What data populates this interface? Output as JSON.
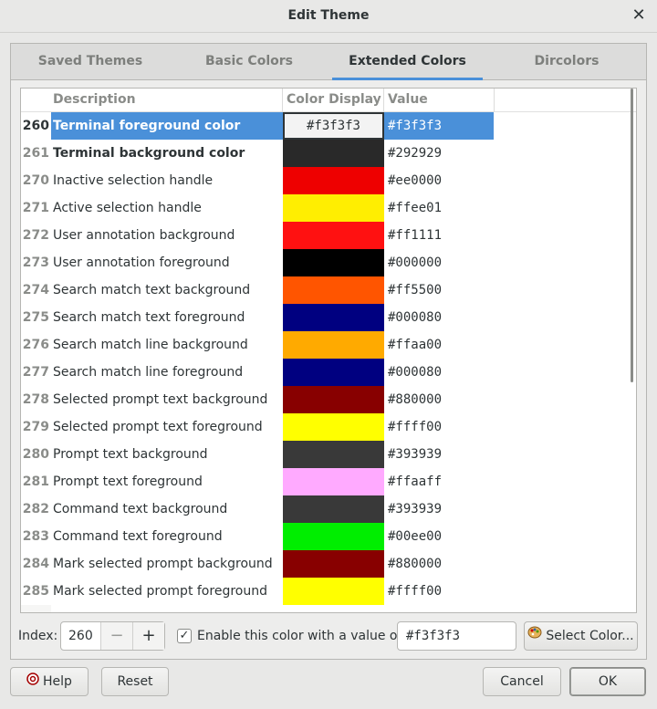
{
  "window": {
    "title": "Edit Theme"
  },
  "tabs": [
    {
      "label": "Saved Themes",
      "active": false
    },
    {
      "label": "Basic Colors",
      "active": false
    },
    {
      "label": "Extended Colors",
      "active": true
    },
    {
      "label": "Dircolors",
      "active": false
    }
  ],
  "columns": {
    "description": "Description",
    "display": "Color Display",
    "value": "Value"
  },
  "rows": [
    {
      "index": "260",
      "description": "Terminal foreground color",
      "value": "#f3f3f3",
      "color": "#f3f3f3",
      "selected": true,
      "bold": true
    },
    {
      "index": "261",
      "description": "Terminal background color",
      "value": "#292929",
      "color": "#292929",
      "bold": true
    },
    {
      "index": "270",
      "description": "Inactive selection handle",
      "value": "#ee0000",
      "color": "#ee0000"
    },
    {
      "index": "271",
      "description": "Active selection handle",
      "value": "#ffee01",
      "color": "#ffee01"
    },
    {
      "index": "272",
      "description": "User annotation background",
      "value": "#ff1111",
      "color": "#ff1111"
    },
    {
      "index": "273",
      "description": "User annotation foreground",
      "value": "#000000",
      "color": "#000000"
    },
    {
      "index": "274",
      "description": "Search match text background",
      "value": "#ff5500",
      "color": "#ff5500"
    },
    {
      "index": "275",
      "description": "Search match text foreground",
      "value": "#000080",
      "color": "#000080"
    },
    {
      "index": "276",
      "description": "Search match line background",
      "value": "#ffaa00",
      "color": "#ffaa00"
    },
    {
      "index": "277",
      "description": "Search match line foreground",
      "value": "#000080",
      "color": "#000080"
    },
    {
      "index": "278",
      "description": "Selected prompt text background",
      "value": "#880000",
      "color": "#880000"
    },
    {
      "index": "279",
      "description": "Selected prompt text foreground",
      "value": "#ffff00",
      "color": "#ffff00"
    },
    {
      "index": "280",
      "description": "Prompt text background",
      "value": "#393939",
      "color": "#393939"
    },
    {
      "index": "281",
      "description": "Prompt text foreground",
      "value": "#ffaaff",
      "color": "#ffaaff"
    },
    {
      "index": "282",
      "description": "Command text background",
      "value": "#393939",
      "color": "#393939"
    },
    {
      "index": "283",
      "description": "Command text foreground",
      "value": "#00ee00",
      "color": "#00ee00"
    },
    {
      "index": "284",
      "description": "Mark selected prompt background",
      "value": "#880000",
      "color": "#880000"
    },
    {
      "index": "285",
      "description": "Mark selected prompt foreground",
      "value": "#ffff00",
      "color": "#ffff00"
    }
  ],
  "index_bar": {
    "index_label": "Index:",
    "index_value": "260",
    "minus": "−",
    "plus": "+",
    "enable_label": "Enable this color with a value of:",
    "enable_checked": true,
    "color_value": "#f3f3f3",
    "select_color_label": "Select Color..."
  },
  "buttons": {
    "help": "Help",
    "reset": "Reset",
    "cancel": "Cancel",
    "ok": "OK"
  },
  "colors": {
    "accent": "#4a90d9",
    "background": "#e8e8e7"
  }
}
